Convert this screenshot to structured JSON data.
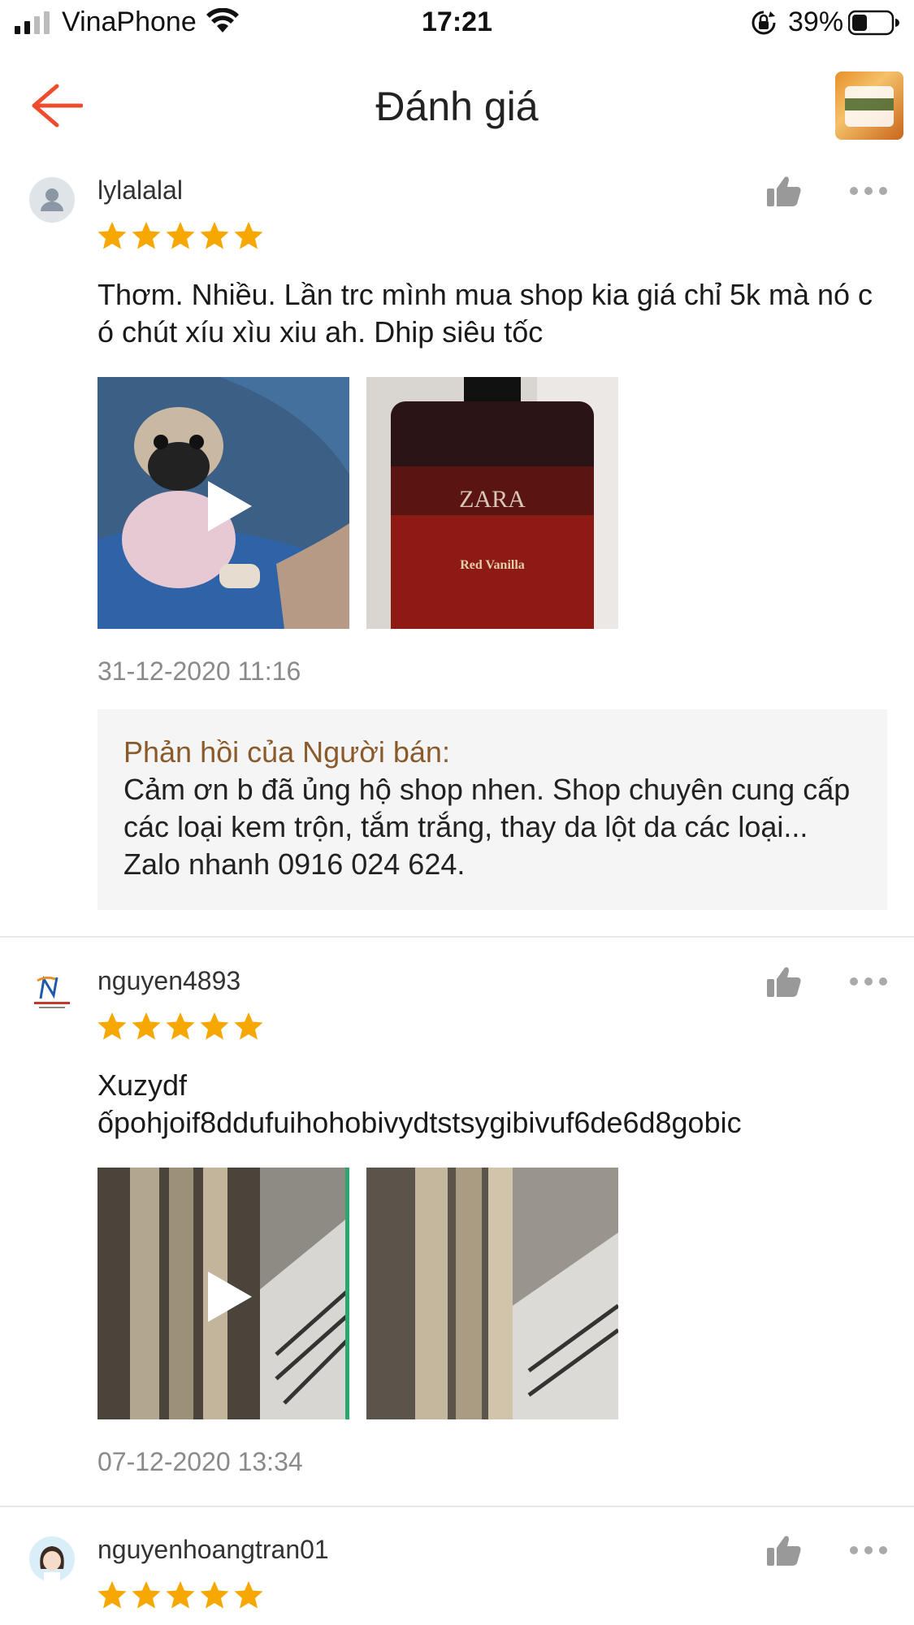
{
  "status_bar": {
    "carrier": "VinaPhone",
    "time": "17:21",
    "battery_percent": "39%",
    "battery_level": 0.39
  },
  "header": {
    "title": "Đánh giá",
    "back_icon": "arrow-left-icon",
    "accent_color": "#ee4d2d"
  },
  "reviews": [
    {
      "username": "lylalalal",
      "rating": 5,
      "comment": "Thơm. Nhiều. Lần trc mình mua shop kia giá chỉ 5k mà nó có chút xíu xìu xiu ah. Dhip siêu tốc",
      "media": [
        {
          "type": "video",
          "label": "pug-video-thumbnail"
        },
        {
          "type": "image",
          "label": "perfume-photo",
          "brand_text": "ZARA",
          "product_text": "Red Vanilla"
        }
      ],
      "date": "31-12-2020 11:16",
      "seller_reply": {
        "title": "Phản hồi của Người bán:",
        "text": "Cảm ơn b đã ủng hộ shop nhen. Shop chuyên cung cấp các loại kem trộn, tắm trắng, thay da lột da các loại... Zalo nhanh 0916 024 624."
      }
    },
    {
      "username": "nguyen4893",
      "rating": 5,
      "comment": "Xuzydf\nốpohjoif8ddufuihohobivydtstsygibivuf6de6d8gobic",
      "media": [
        {
          "type": "video",
          "label": "stairs-video-thumbnail"
        },
        {
          "type": "image",
          "label": "stairs-photo"
        }
      ],
      "date": "07-12-2020 13:34"
    },
    {
      "username": "nguyenhoangtran01",
      "rating": 5
    }
  ],
  "colors": {
    "star": "#f6a700",
    "reply_title": "#8b5a2b",
    "date": "#8a8a8a"
  }
}
